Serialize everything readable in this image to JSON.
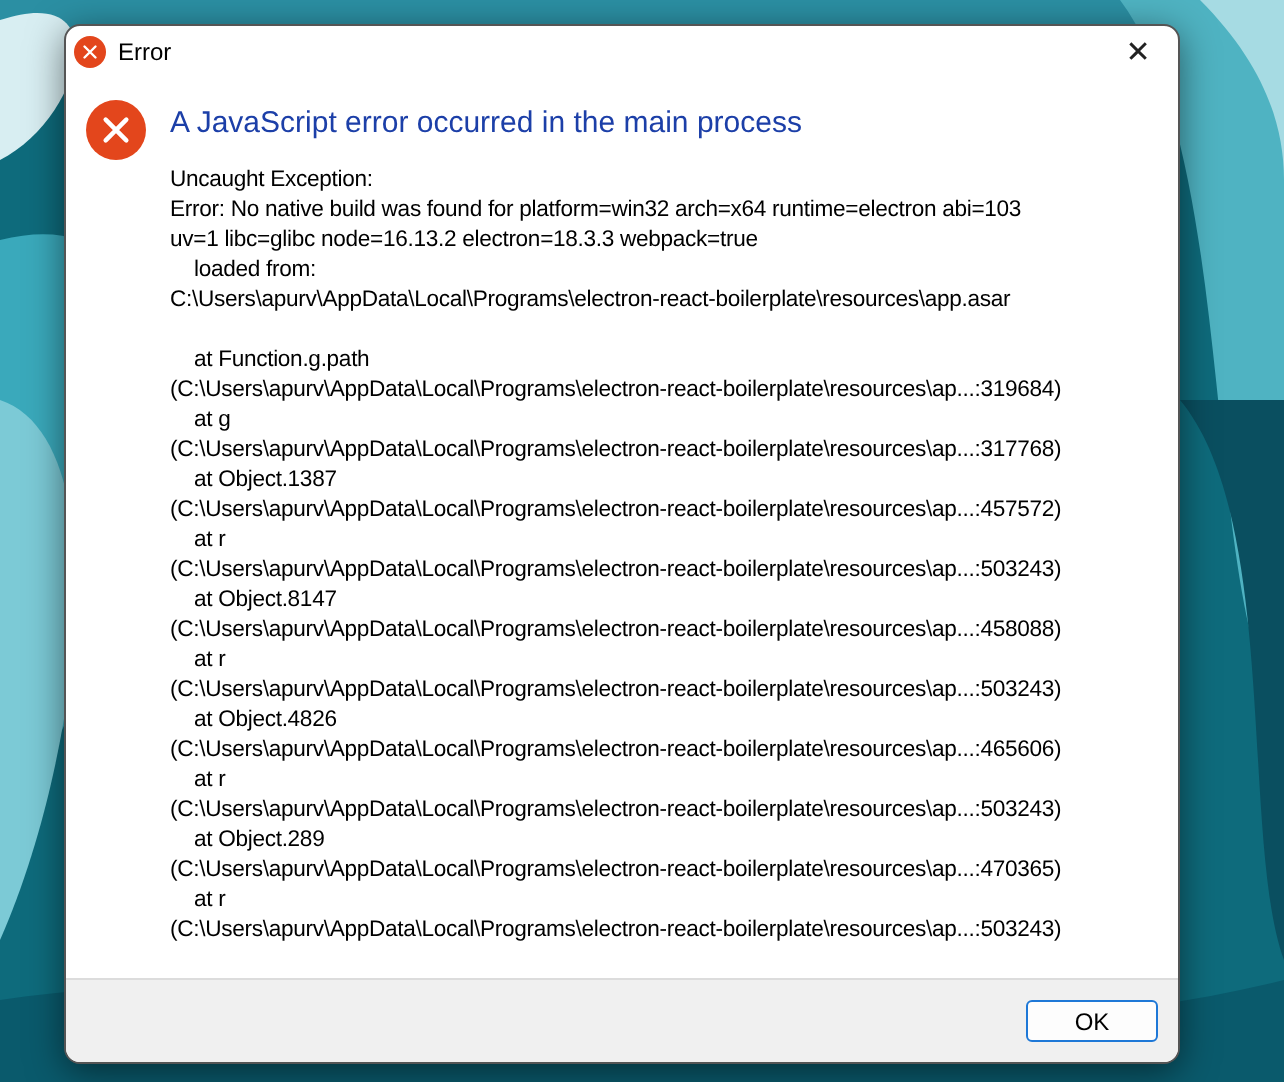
{
  "window": {
    "title": "Error",
    "close_glyph": "✕"
  },
  "heading": "A JavaScript error occurred in the main process",
  "message_lines": [
    "Uncaught Exception:",
    "Error: No native build was found for platform=win32 arch=x64 runtime=electron abi=103",
    "uv=1 libc=glibc node=16.13.2 electron=18.3.3 webpack=true",
    "    loaded from:",
    "C:\\Users\\apurv\\AppData\\Local\\Programs\\electron-react-boilerplate\\resources\\app.asar"
  ],
  "stack_lines": [
    "    at Function.g.path",
    "(C:\\Users\\apurv\\AppData\\Local\\Programs\\electron-react-boilerplate\\resources\\ap...:319684)",
    "    at g",
    "(C:\\Users\\apurv\\AppData\\Local\\Programs\\electron-react-boilerplate\\resources\\ap...:317768)",
    "    at Object.1387",
    "(C:\\Users\\apurv\\AppData\\Local\\Programs\\electron-react-boilerplate\\resources\\ap...:457572)",
    "    at r",
    "(C:\\Users\\apurv\\AppData\\Local\\Programs\\electron-react-boilerplate\\resources\\ap...:503243)",
    "    at Object.8147",
    "(C:\\Users\\apurv\\AppData\\Local\\Programs\\electron-react-boilerplate\\resources\\ap...:458088)",
    "    at r",
    "(C:\\Users\\apurv\\AppData\\Local\\Programs\\electron-react-boilerplate\\resources\\ap...:503243)",
    "    at Object.4826",
    "(C:\\Users\\apurv\\AppData\\Local\\Programs\\electron-react-boilerplate\\resources\\ap...:465606)",
    "    at r",
    "(C:\\Users\\apurv\\AppData\\Local\\Programs\\electron-react-boilerplate\\resources\\ap...:503243)",
    "    at Object.289",
    "(C:\\Users\\apurv\\AppData\\Local\\Programs\\electron-react-boilerplate\\resources\\ap...:470365)",
    "    at r",
    "(C:\\Users\\apurv\\AppData\\Local\\Programs\\electron-react-boilerplate\\resources\\ap...:503243)"
  ],
  "buttons": [
    {
      "label": "OK",
      "default": true
    }
  ]
}
